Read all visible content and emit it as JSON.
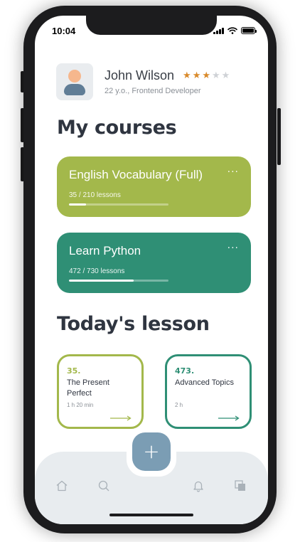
{
  "status_bar": {
    "time": "10:04"
  },
  "profile": {
    "name": "John Wilson",
    "subtitle": "22 y.o., Frontend Developer",
    "rating": 3,
    "rating_max": 5,
    "avatar_icon": "user-avatar-icon"
  },
  "courses": {
    "title": "My courses",
    "items": [
      {
        "name": "English Vocabulary (Full)",
        "progress_text": "35 / 210 lessons",
        "progress": 0.17,
        "menu": "···",
        "color": "#a3b84b"
      },
      {
        "name": "Learn Python",
        "progress_text": "472 / 730 lessons",
        "progress": 0.65,
        "menu": "···",
        "color": "#2f8f75"
      }
    ]
  },
  "today": {
    "title": "Today's lesson",
    "lessons": [
      {
        "number": "35.",
        "name": "The Present Perfect",
        "duration": "1 h 20 min",
        "color": "#a3b84b"
      },
      {
        "number": "473.",
        "name": "Advanced Topics",
        "duration": "2 h",
        "color": "#2f8f75"
      }
    ]
  },
  "nav": {
    "fab_label": "+",
    "icons": [
      "home-icon",
      "search-icon",
      "bell-icon",
      "pages-icon"
    ]
  },
  "colors": {
    "accent_green": "#a3b84b",
    "accent_teal": "#2f8f75",
    "fab": "#7b9db4"
  }
}
